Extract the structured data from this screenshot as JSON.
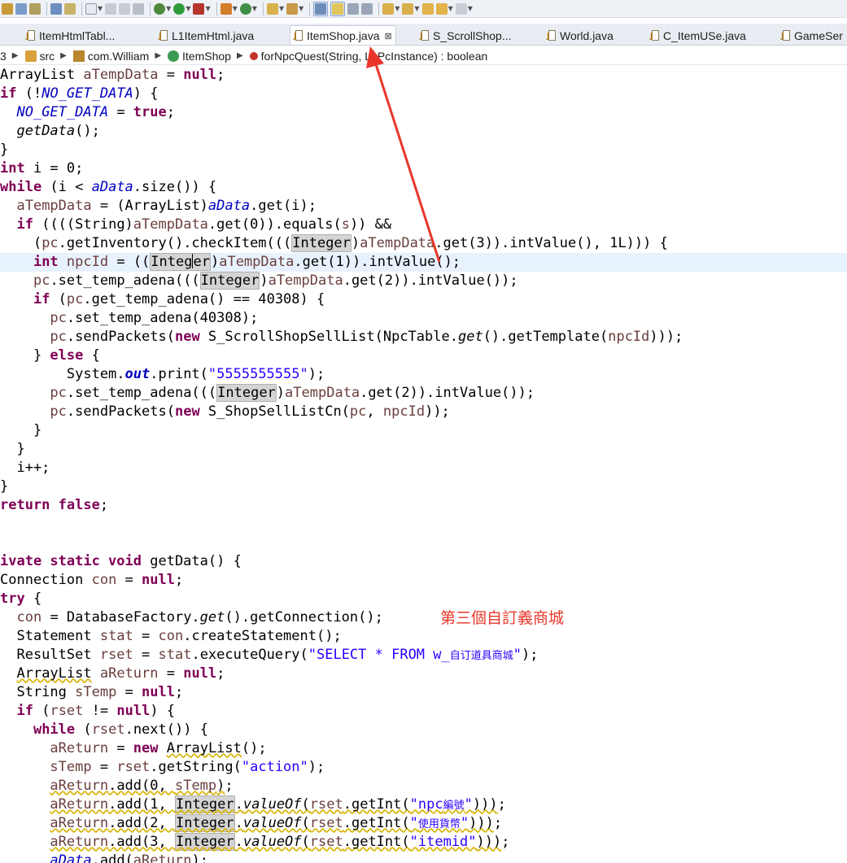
{
  "tabs": [
    {
      "label": "ItemHtmlTabl...",
      "active": false
    },
    {
      "label": "L1ItemHtml.java",
      "active": false
    },
    {
      "label": "ItemShop.java",
      "active": true
    },
    {
      "label": "S_ScrollShop...",
      "active": false
    },
    {
      "label": "World.java",
      "active": false
    },
    {
      "label": "C_ItemUSe.java",
      "active": false
    },
    {
      "label": "GameSer",
      "active": false
    }
  ],
  "tab_close_glyph": "⊠",
  "breadcrumb": {
    "lead": "3",
    "src": "src",
    "package": "com.William",
    "class": "ItemShop",
    "method": "forNpcQuest(String, L1PcInstance) : boolean"
  },
  "annotation": {
    "text": "第三個自訂義商城",
    "color": "#e8372a"
  },
  "code": {
    "cjk_table": "自订道具商城",
    "cjk_npc": "編號",
    "cjk_currency": "使用貨幣",
    "string_digits": "\"5555555555\"",
    "string_action": "\"action\"",
    "string_itemid": "\"itemid\"",
    "string_select_prefix": "\"SELECT * FROM w_",
    "number_40308": "40308",
    "keyword_null": "null",
    "keyword_true": "true",
    "keyword_false": "false"
  },
  "colors": {
    "keyword": "#7f0055",
    "field": "#0000c0",
    "string": "#2a00ff",
    "current_line": "#e8f2fe",
    "arrow": "#e8372a"
  }
}
